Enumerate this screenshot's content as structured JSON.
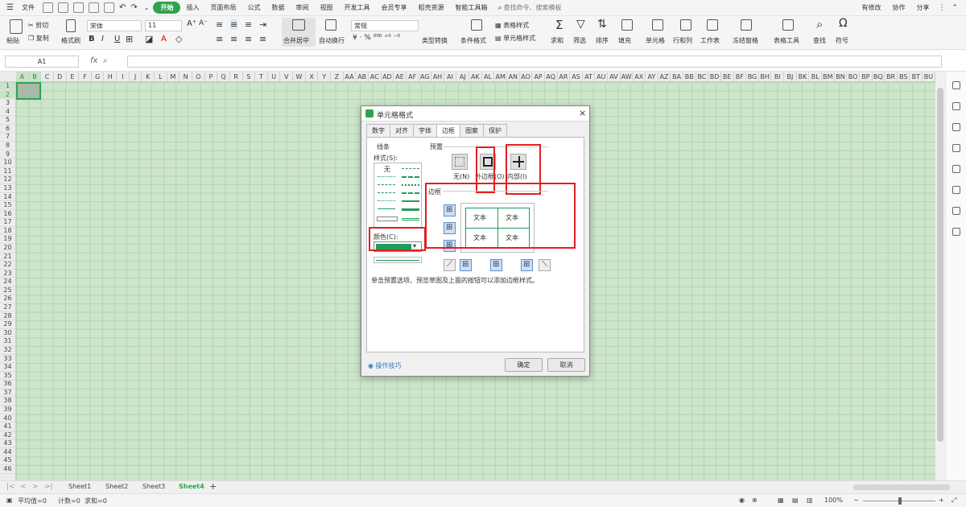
{
  "menubar": {
    "file_label": "文件",
    "tabs": [
      "开始",
      "插入",
      "页面布局",
      "公式",
      "数据",
      "审阅",
      "视图",
      "开发工具",
      "会员专享",
      "稻壳资源",
      "智能工具箱"
    ],
    "search_placeholder": "查找命令、搜索模板",
    "has_changes": "有修改",
    "collab": "协作",
    "share": "分享"
  },
  "ribbon": {
    "paste": "粘贴",
    "cut": "剪切",
    "copy": "复制",
    "format_painter": "格式刷",
    "font_name": "宋体",
    "font_size": "11",
    "bold": "B",
    "italic": "I",
    "underline": "U",
    "merge_center": "合并居中",
    "wrap_text": "自动换行",
    "number_format": "常规",
    "type_convert": "类型转换",
    "cond_format": "条件格式",
    "table_style": "表格样式",
    "cell_style": "单元格样式",
    "sum": "求和",
    "filter": "筛选",
    "sort": "排序",
    "fill": "填充",
    "cell": "单元格",
    "row_col": "行和列",
    "worksheet": "工作表",
    "freeze": "冻结窗格",
    "table_tools": "表格工具",
    "find": "查找",
    "symbol": "符号"
  },
  "formula_bar": {
    "name_box": "A1",
    "fx": "fx",
    "value": ""
  },
  "columns": [
    "A",
    "B",
    "C",
    "D",
    "E",
    "F",
    "G",
    "H",
    "I",
    "J",
    "K",
    "L",
    "M",
    "N",
    "O",
    "P",
    "Q",
    "R",
    "S",
    "T",
    "U",
    "V",
    "W",
    "X",
    "Y",
    "Z",
    "AA",
    "AB",
    "AC",
    "AD",
    "AE",
    "AF",
    "AG",
    "AH",
    "AI",
    "AJ",
    "AK",
    "AL",
    "AM",
    "AN",
    "AO",
    "AP",
    "AQ",
    "AR",
    "AS",
    "AT",
    "AU",
    "AV",
    "AW",
    "AX",
    "AY",
    "AZ",
    "BA",
    "BB",
    "BC",
    "BD",
    "BE",
    "BF",
    "BG",
    "BH",
    "BI",
    "BJ",
    "BK",
    "BL",
    "BM",
    "BN",
    "BO",
    "BP",
    "BQ",
    "BR",
    "BS",
    "BT",
    "BU"
  ],
  "rows": [
    "1",
    "2",
    "3",
    "4",
    "5",
    "6",
    "7",
    "8",
    "9",
    "10",
    "11",
    "12",
    "13",
    "14",
    "15",
    "16",
    "17",
    "18",
    "19",
    "20",
    "21",
    "22",
    "23",
    "24",
    "25",
    "26",
    "27",
    "28",
    "29",
    "30",
    "31",
    "32",
    "33",
    "34",
    "35",
    "36",
    "37",
    "38",
    "39",
    "40",
    "41",
    "42",
    "43",
    "44",
    "45",
    "46"
  ],
  "sheets": [
    "Sheet1",
    "Sheet2",
    "Sheet3",
    "Sheet4"
  ],
  "active_sheet": "Sheet4",
  "status": {
    "average": "平均值=0",
    "count": "计数=0",
    "sum": "求和=0",
    "zoom": "100%"
  },
  "dialog": {
    "title": "单元格格式",
    "tabs": [
      "数字",
      "对齐",
      "字体",
      "边框",
      "图案",
      "保护"
    ],
    "active_tab": "边框",
    "line_group": "线条",
    "style_label": "样式(S):",
    "style_none": "无",
    "color_label": "颜色(C):",
    "preset_group": "预置",
    "preset_none": "无(N)",
    "preset_outline": "外边框(O)",
    "preset_inside": "内部(I)",
    "border_group": "边框",
    "preview_text": "文本",
    "hint": "单击预置选项、预览草图及上面的按钮可以添加边框样式。",
    "tips": "操作技巧",
    "ok": "确定",
    "cancel": "取消"
  },
  "colors": {
    "accent": "#2ea34f",
    "grid_bg": "#cde5cb",
    "border_color": "#1e9c5a",
    "highlight": "#e02020"
  }
}
